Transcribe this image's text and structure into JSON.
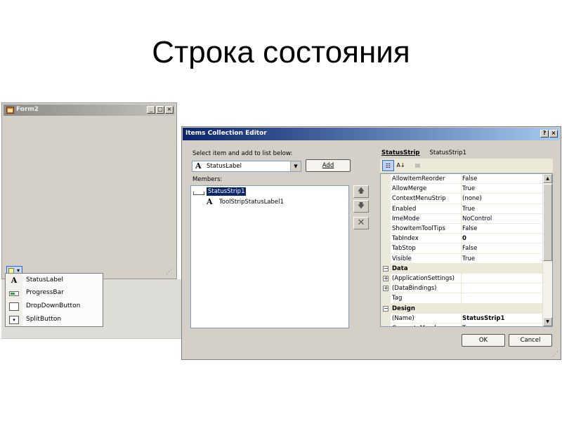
{
  "slide": {
    "title": "Строка состояния"
  },
  "form2": {
    "title": "Form2",
    "caption_buttons": [
      "_",
      "□",
      "×"
    ],
    "dropdown_menu": [
      {
        "label": "StatusLabel",
        "icon": "status-label-icon"
      },
      {
        "label": "ProgressBar",
        "icon": "progress-bar-icon"
      },
      {
        "label": "DropDownButton",
        "icon": "dropdown-button-icon"
      },
      {
        "label": "SplitButton",
        "icon": "split-button-icon"
      }
    ]
  },
  "editor": {
    "title": "Items Collection Editor",
    "caption_buttons": [
      "?",
      "×"
    ],
    "select_label": "Select item and add to list below:",
    "combo_icon": "A",
    "combo_value": "StatusLabel",
    "add_label": "Add",
    "members_label": "Members:",
    "members": [
      {
        "label": "StatusStrip1",
        "selected": true
      },
      {
        "label": "ToolStripStatusLabel1",
        "selected": false
      }
    ],
    "object_type": "StatusStrip",
    "object_name": "StatusStrip1",
    "properties": [
      {
        "type": "prop",
        "name": "AllowItemReorder",
        "value": "False"
      },
      {
        "type": "prop",
        "name": "AllowMerge",
        "value": "True"
      },
      {
        "type": "prop",
        "name": "ContextMenuStrip",
        "value": "(none)"
      },
      {
        "type": "prop",
        "name": "Enabled",
        "value": "True"
      },
      {
        "type": "prop",
        "name": "ImeMode",
        "value": "NoControl"
      },
      {
        "type": "prop",
        "name": "ShowItemToolTips",
        "value": "False"
      },
      {
        "type": "prop",
        "name": "TabIndex",
        "value": "0",
        "bold": true
      },
      {
        "type": "prop",
        "name": "TabStop",
        "value": "False"
      },
      {
        "type": "prop",
        "name": "Visible",
        "value": "True"
      },
      {
        "type": "category",
        "name": "Data"
      },
      {
        "type": "expandable",
        "name": "(ApplicationSettings)",
        "value": ""
      },
      {
        "type": "expandable",
        "name": "(DataBindings)",
        "value": ""
      },
      {
        "type": "prop",
        "name": "Tag",
        "value": ""
      },
      {
        "type": "category",
        "name": "Design"
      },
      {
        "type": "prop",
        "name": "(Name)",
        "value": "StatusStrip1",
        "bold": true
      },
      {
        "type": "prop",
        "name": "GenerateMember",
        "value": "True"
      }
    ],
    "ok_label": "OK",
    "cancel_label": "Cancel"
  }
}
